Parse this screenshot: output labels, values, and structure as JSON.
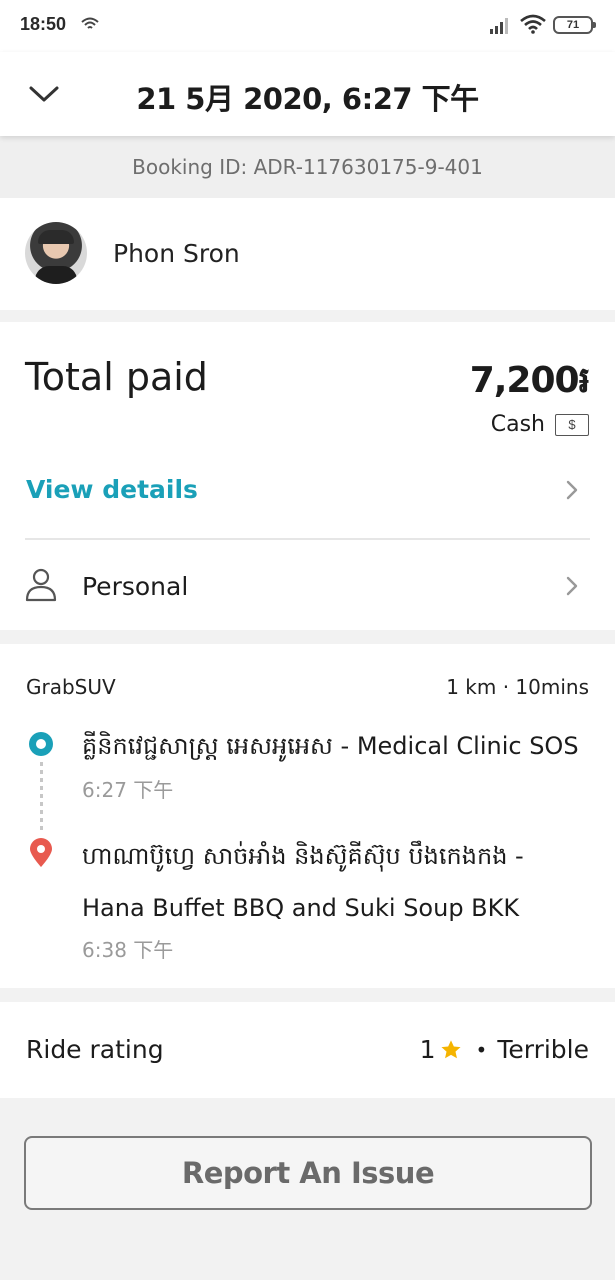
{
  "status_bar": {
    "time": "18:50",
    "battery": "71",
    "icons": [
      "hotspot-icon",
      "signal-icon",
      "wifi-icon",
      "battery-icon"
    ]
  },
  "header": {
    "title": "21 5月 2020, 6:27 下午",
    "back_icon": "chevron-down-icon"
  },
  "booking": {
    "id_text": "Booking ID: ADR-117630175-9-401"
  },
  "driver": {
    "name": "Phon Sron"
  },
  "payment": {
    "total_label": "Total paid",
    "total_amount": "7,200៛",
    "method": "Cash",
    "method_icon": "$",
    "view_details": "View details",
    "profile": "Personal"
  },
  "ride": {
    "service": "GrabSUV",
    "meta": "1 km · 10mins",
    "pickup": {
      "name": "គ្លីនិកវេជ្ជសាស្ត្រ អេសអូអេស - Medical Clinic SOS",
      "time": "6:27 下午"
    },
    "dropoff": {
      "name_line1": "ហាណាប៊ូហ្វេ សាច់អាំង និងស៊ូគីស៊ុប បឹងកេងកង -",
      "name_line2": "Hana Buffet BBQ and Suki Soup BKK",
      "time": "6:38 下午"
    }
  },
  "rating": {
    "label": "Ride rating",
    "score": "1",
    "bullet": "•",
    "text": "Terrible"
  },
  "actions": {
    "report": "Report An Issue"
  },
  "colors": {
    "accent": "#1aa0b8",
    "pin": "#e85a4f",
    "star": "#f5b400",
    "background": "#f2f2f2"
  }
}
